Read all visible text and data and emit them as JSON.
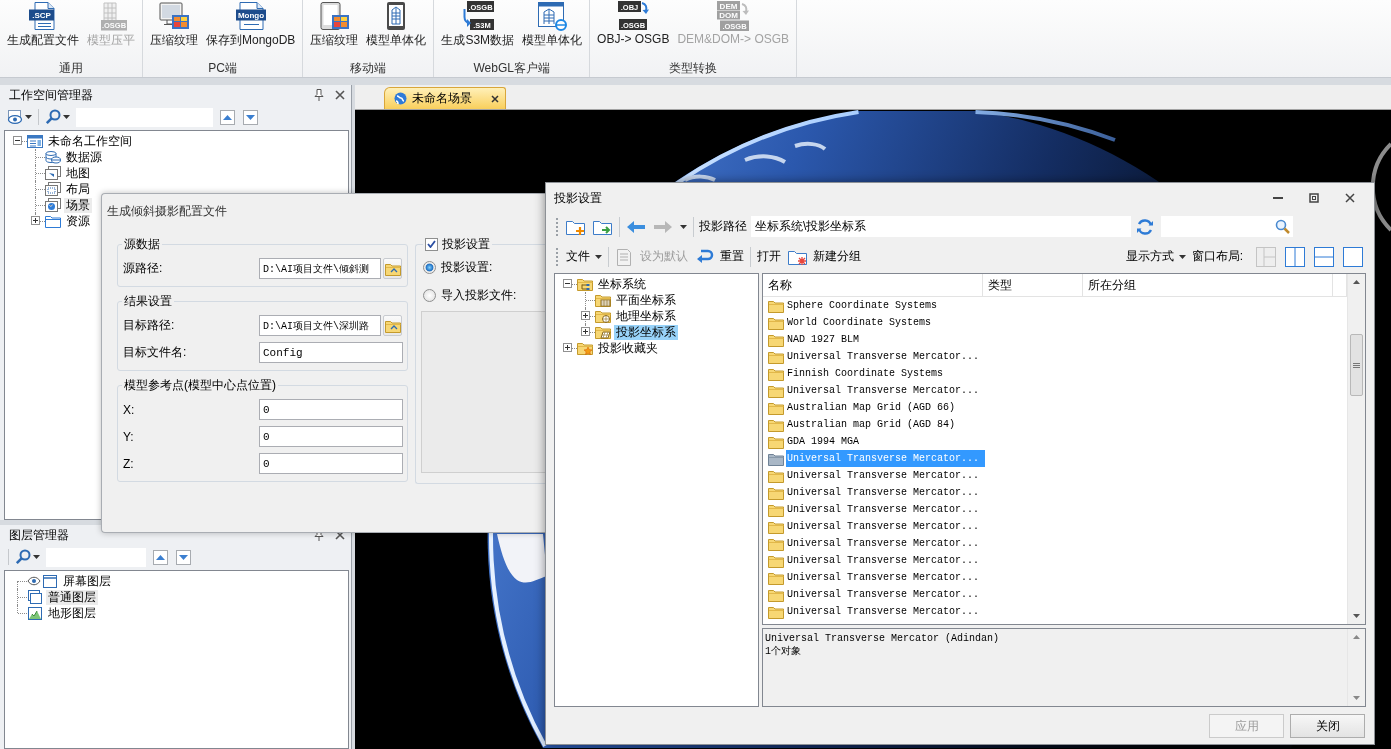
{
  "ribbon": {
    "groups": [
      {
        "label": "通用",
        "buttons": [
          {
            "label": "生成配置文件",
            "icon_text": [
              ".SCP"
            ],
            "disabled": false
          },
          {
            "label": "模型压平",
            "icon_text": [
              ".OSGB"
            ],
            "disabled": true
          }
        ]
      },
      {
        "label": "PC端",
        "buttons": [
          {
            "label": "压缩纹理",
            "disabled": false
          },
          {
            "label": "保存到MongoDB",
            "icon_text": [
              "Mongo"
            ],
            "disabled": false
          }
        ]
      },
      {
        "label": "移动端",
        "buttons": [
          {
            "label": "压缩纹理",
            "disabled": false
          },
          {
            "label": "模型单体化",
            "disabled": false
          }
        ]
      },
      {
        "label": "WebGL客户端",
        "buttons": [
          {
            "label": "生成S3M数据",
            "icon_text": [
              ".OSGB",
              ".S3M"
            ],
            "disabled": false
          },
          {
            "label": "模型单体化",
            "disabled": false
          }
        ]
      },
      {
        "label": "类型转换",
        "buttons": [
          {
            "label": "OBJ-> OSGB",
            "icon_text": [
              ".OBJ",
              ".OSGB"
            ],
            "disabled": false
          },
          {
            "label": "DEM&DOM-> OSGB",
            "icon_text": [
              "DEM",
              "DOM",
              ".OSGB"
            ],
            "disabled": true
          }
        ]
      }
    ]
  },
  "workspace": {
    "title": "工作空间管理器",
    "tree": [
      {
        "label": "未命名工作空间",
        "expanded": true,
        "selected": false,
        "children": [
          {
            "label": "数据源",
            "selected": false
          },
          {
            "label": "地图",
            "selected": false
          },
          {
            "label": "布局",
            "selected": false
          },
          {
            "label": "场景",
            "selected": true
          },
          {
            "label": "资源",
            "expanded": false,
            "selected": false
          }
        ]
      }
    ]
  },
  "layers": {
    "title": "图层管理器",
    "tree": [
      {
        "label": "屏幕图层",
        "visible": true,
        "selected": false
      },
      {
        "label": "普通图层",
        "visible": false,
        "selected": true
      },
      {
        "label": "地形图层",
        "visible": false,
        "selected": false
      }
    ]
  },
  "scene": {
    "tabs": [
      {
        "label": "未命名场景",
        "selected": true
      }
    ]
  },
  "config_dialog": {
    "title": "生成倾斜摄影配置文件",
    "groups": [
      {
        "title": "源数据",
        "fields": [
          {
            "kind": "path",
            "label": "源路径:",
            "value": "D:\\AI项目文件\\倾斜测"
          }
        ]
      },
      {
        "title": "结果设置",
        "fields": [
          {
            "kind": "path",
            "label": "目标路径:",
            "value": "D:\\AI项目文件\\深圳路"
          },
          {
            "kind": "text",
            "label": "目标文件名:",
            "value": "Config"
          }
        ]
      },
      {
        "title": "模型参考点(模型中心点位置)",
        "fields": [
          {
            "kind": "text",
            "label": "X:",
            "value": "0"
          },
          {
            "kind": "text",
            "label": "Y:",
            "value": "0"
          },
          {
            "kind": "text",
            "label": "Z:",
            "value": "0"
          }
        ]
      }
    ],
    "projection": {
      "label": "投影设置",
      "checked": true,
      "options": [
        {
          "label": "投影设置:",
          "selected": true
        },
        {
          "label": "导入投影文件:",
          "selected": false
        }
      ]
    }
  },
  "projection_dialog": {
    "title": "投影设置",
    "nav_buttons": [
      {
        "disabled": false
      },
      {
        "disabled": true
      }
    ],
    "path_label": "投影路径",
    "path": "坐标系统\\投影坐标系",
    "toolbar": [
      {
        "kind": "menu",
        "label": "文件",
        "disabled": false
      },
      {
        "kind": "icon",
        "label": "设为默认",
        "disabled": true
      },
      {
        "kind": "icon",
        "label": "重置",
        "disabled": false
      },
      {
        "kind": "plain",
        "label": "打开",
        "disabled": false
      },
      {
        "kind": "icon",
        "label": "新建分组",
        "disabled": false
      }
    ],
    "view_menu": "显示方式",
    "layout_label": "窗口布局:",
    "layouts": [
      {
        "disabled": true
      },
      {
        "disabled": false
      },
      {
        "disabled": false
      },
      {
        "disabled": false
      }
    ],
    "tree": [
      {
        "label": "坐标系统",
        "expanded": true,
        "selected": false,
        "children": [
          {
            "label": "平面坐标系",
            "selected": false
          },
          {
            "label": "地理坐标系",
            "expanded": false,
            "selected": false
          },
          {
            "label": "投影坐标系",
            "expanded": false,
            "selected": true
          }
        ]
      },
      {
        "label": "投影收藏夹",
        "expanded": false,
        "selected": false
      }
    ],
    "columns": [
      "名称",
      "类型",
      "所在分组"
    ],
    "rows": [
      {
        "name": "Sphere Coordinate Systems",
        "selected": false
      },
      {
        "name": "World Coordinate Systems",
        "selected": false
      },
      {
        "name": "NAD 1927 BLM",
        "selected": false
      },
      {
        "name": "Universal Transverse Mercator...",
        "selected": false
      },
      {
        "name": "Finnish Coordinate Systems",
        "selected": false
      },
      {
        "name": "Universal Transverse Mercator...",
        "selected": false
      },
      {
        "name": "Australian Map Grid (AGD 66)",
        "selected": false
      },
      {
        "name": "Australian map Grid (AGD 84)",
        "selected": false
      },
      {
        "name": "GDA 1994 MGA",
        "selected": false
      },
      {
        "name": "Universal Transverse Mercator...",
        "selected": true
      },
      {
        "name": "Universal Transverse Mercator...",
        "selected": false
      },
      {
        "name": "Universal Transverse Mercator...",
        "selected": false
      },
      {
        "name": "Universal Transverse Mercator...",
        "selected": false
      },
      {
        "name": "Universal Transverse Mercator...",
        "selected": false
      },
      {
        "name": "Universal Transverse Mercator...",
        "selected": false
      },
      {
        "name": "Universal Transverse Mercator...",
        "selected": false
      },
      {
        "name": "Universal Transverse Mercator...",
        "selected": false
      },
      {
        "name": "Universal Transverse Mercator...",
        "selected": false
      },
      {
        "name": "Universal Transverse Mercator...",
        "selected": false
      }
    ],
    "details": [
      "Universal Transverse Mercator (Adindan)",
      "1个对象"
    ],
    "buttons": [
      {
        "label": "应用",
        "disabled": true
      },
      {
        "label": "关闭",
        "disabled": false
      }
    ]
  }
}
